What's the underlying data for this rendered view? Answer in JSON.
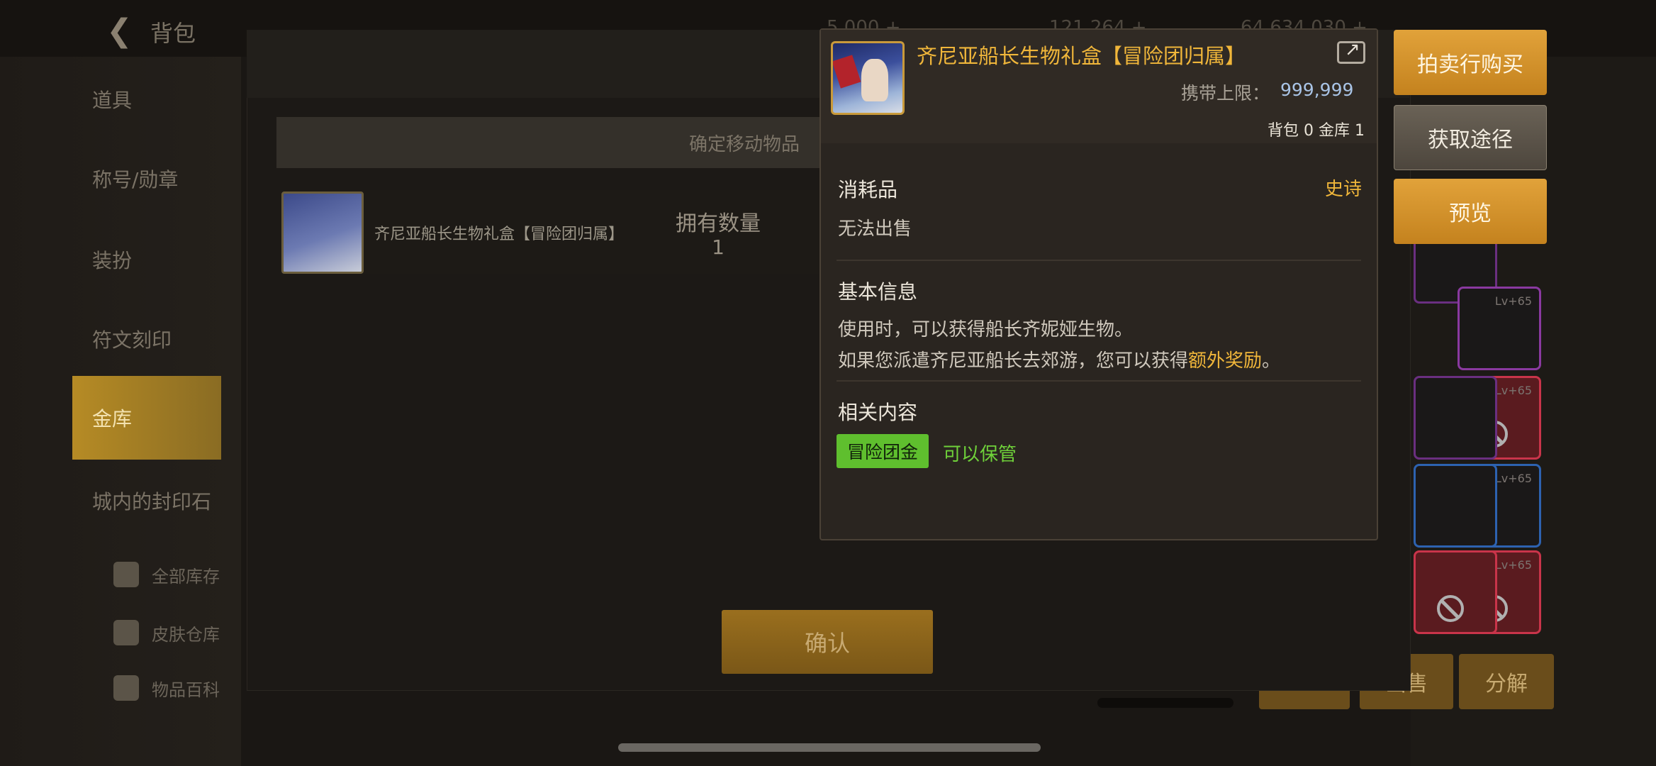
{
  "topbar": {
    "back_icon": "back-arrow-icon",
    "title": "背包",
    "readouts": [
      "5,000 +",
      "121,264 +",
      "64,634,030 +"
    ]
  },
  "sidebar": {
    "items": [
      {
        "label": "道具"
      },
      {
        "label": "称号/勋章"
      },
      {
        "label": "装扮"
      },
      {
        "label": "符文刻印"
      },
      {
        "label": "金库",
        "active": true
      },
      {
        "label": "城内的封印石"
      }
    ],
    "sub_items": [
      {
        "label": "全部库存",
        "icon": "storage-icon"
      },
      {
        "label": "皮肤仓库",
        "icon": "wardrobe-icon"
      },
      {
        "label": "物品百科",
        "icon": "encyclopedia-icon"
      }
    ]
  },
  "dialog": {
    "move_bar": "确定移动物品",
    "item_name": "齐尼亚船长生物礼盒【冒险团归属】",
    "qty_label": "拥有数量",
    "qty_value": "1",
    "confirm_label": "确认"
  },
  "tooltip": {
    "title": "齐尼亚船长生物礼盒【冒险团归属】",
    "carry_label": "携带上限：",
    "carry_value": "999,999",
    "bag_label": "背包",
    "bag_count": "0",
    "vault_label": "金库",
    "vault_count": "1",
    "category": "消耗品",
    "rarity": "史诗",
    "sell_status": "无法出售",
    "basic_info_title": "基本信息",
    "desc_line1": "使用时，可以获得船长齐妮娅生物。",
    "desc_line2_prefix": "如果您派遣齐尼亚船长去郊游，您可以获得",
    "desc_line2_highlight": "额外奖励",
    "desc_line2_suffix": "。",
    "related_title": "相关内容",
    "chip_label": "冒险团金",
    "chip_status": "可以保管",
    "colors": {
      "title": "#f0b63a",
      "chip": "#5fbf2e",
      "status_green": "#6fd13a"
    }
  },
  "actions": {
    "auction_buy": "拍卖行购买",
    "obtain_route": "获取途径",
    "preview": "预览"
  },
  "inventory": {
    "level_label": "Lv+65",
    "sell_label": "出售",
    "disassemble_label": "分解"
  }
}
